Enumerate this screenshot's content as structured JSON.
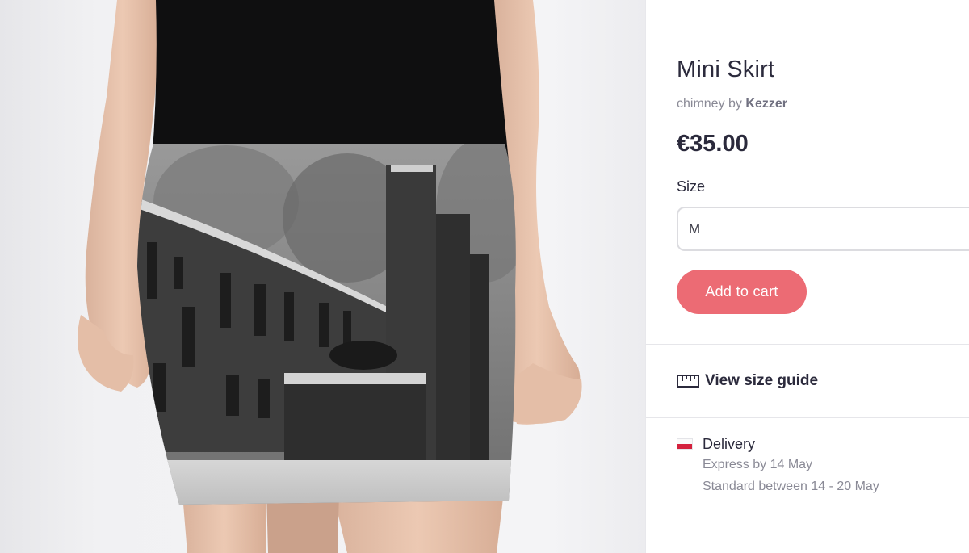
{
  "product": {
    "title": "Mini Skirt",
    "design_name": "chimney",
    "by_word": "by",
    "artist": "Kezzer",
    "price": "€35.00"
  },
  "size": {
    "label": "Size",
    "selected": "M"
  },
  "cart": {
    "add_label": "Add to cart"
  },
  "size_guide": {
    "label": "View size guide"
  },
  "delivery": {
    "title": "Delivery",
    "express": "Express by 14 May",
    "standard": "Standard between 14 - 20 May",
    "flag": "poland-flag-icon"
  },
  "colors": {
    "accent": "#ec6b74",
    "text_dark": "#2b2a3c",
    "text_muted": "#8a8a96"
  }
}
